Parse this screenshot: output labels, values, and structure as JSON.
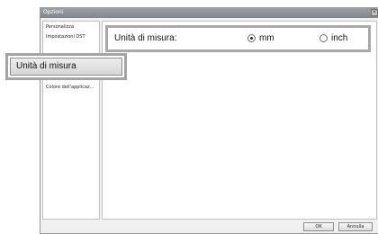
{
  "window": {
    "title": "Opzioni"
  },
  "sidebar": {
    "items": [
      {
        "label": "Personalizza"
      },
      {
        "label": "Impostazioni DST"
      },
      {
        "label": "Colore dell'applicaz..."
      }
    ]
  },
  "units": {
    "label": "Unità di misura:",
    "options": [
      {
        "label": "mm",
        "selected": true
      },
      {
        "label": "inch",
        "selected": false
      }
    ]
  },
  "callout": {
    "label": "Unità di misura"
  },
  "footer": {
    "ok_label": "OK",
    "cancel_label": "Annulla"
  }
}
